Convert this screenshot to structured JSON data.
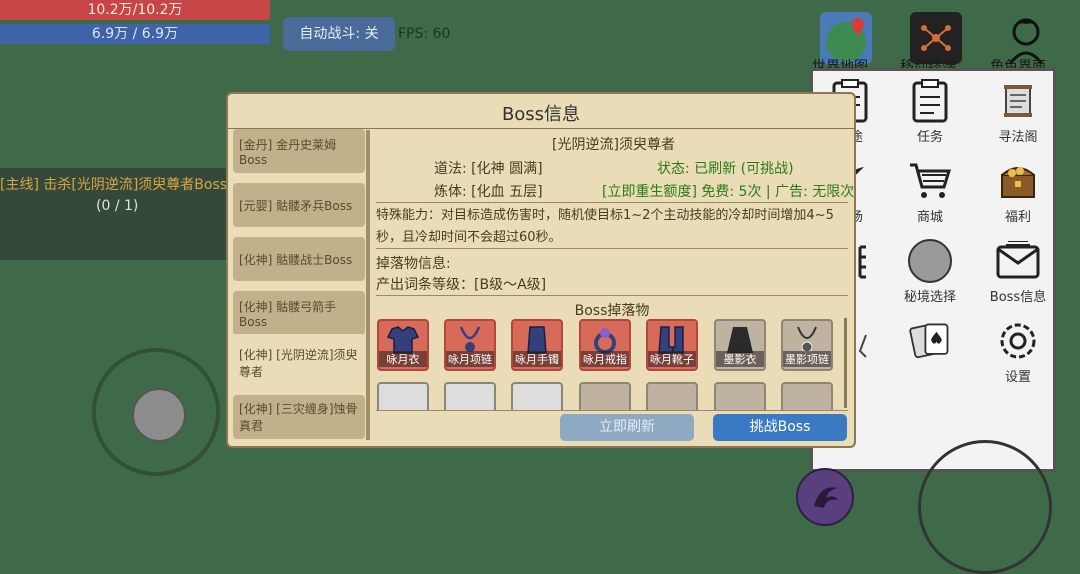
{
  "hud": {
    "hp": "10.2万/10.2万",
    "mp": "6.9万 / 6.9万",
    "auto_battle": "自动战斗: 关",
    "fps": "FPS: 60",
    "quest": "[主线] 击杀[光阴逆流]须臾尊者Boss",
    "quest_progress": "(0 / 1)"
  },
  "top_icons": [
    {
      "label": "世界地图",
      "icon": "map-pin-icon"
    },
    {
      "label": "移动终端",
      "icon": "network-icon"
    },
    {
      "label": "角色界面",
      "icon": "avatar-icon"
    }
  ],
  "side_menu": {
    "items": [
      {
        "label": "用途",
        "icon": "clipboard-icon"
      },
      {
        "label": "任务",
        "icon": "task-icon"
      },
      {
        "label": "寻法阁",
        "icon": "scroll-icon"
      },
      {
        "label": "商场",
        "icon": "feather-icon"
      },
      {
        "label": "商城",
        "icon": "cart-icon"
      },
      {
        "label": "福利",
        "icon": "treasure-icon"
      },
      {
        "label": "",
        "icon": "grid-icon"
      },
      {
        "label": "秘境选择",
        "icon": "circle-icon"
      },
      {
        "label": "Boss信息",
        "icon": "mail-icon"
      },
      {
        "label": "",
        "icon": "sword-icon"
      },
      {
        "label": "",
        "icon": "cards-icon"
      },
      {
        "label": "设置",
        "icon": "gear-icon"
      }
    ]
  },
  "modal": {
    "title": "Boss信息",
    "list": [
      "[金丹] 金丹史莱姆Boss",
      "[元婴] 骷髅矛兵Boss",
      "[化神] 骷髅战士Boss",
      "[化神] 骷髅弓箭手Boss",
      "[化神] [光阴逆流]须臾尊者",
      "[化神] [三灾缠身]蚀骨真君"
    ],
    "selected_index": 4,
    "detail": {
      "name": "[光阴逆流]须臾尊者",
      "dao": "道法: [化神 圆满]",
      "status": "状态: 已刷新 (可挑战)",
      "body": "炼体: [化血 五层]",
      "respawn": "[立即重生额度] 免费: 5次 | 广告: 无限次",
      "ability": "特殊能力：对目标造成伤害时，随机使目标1~2个主动技能的冷却时间增加4~5秒，且冷却时间不会超过60秒。",
      "drop_info_title": "掉落物信息:",
      "drop_grade": "产出词条等级：[B级～A级]",
      "drops_title": "Boss掉落物"
    },
    "drops": [
      {
        "label": "咏月衣",
        "style": "red",
        "icon": "armor-icon"
      },
      {
        "label": "咏月项链",
        "style": "red",
        "icon": "necklace-icon"
      },
      {
        "label": "咏月手镯",
        "style": "red",
        "icon": "bracer-icon"
      },
      {
        "label": "咏月戒指",
        "style": "red",
        "icon": "ring-icon"
      },
      {
        "label": "咏月靴子",
        "style": "red",
        "icon": "boots-icon"
      },
      {
        "label": "墨影衣",
        "style": "gray",
        "icon": "robe-icon"
      },
      {
        "label": "墨影项链",
        "style": "gray",
        "icon": "necklace-icon"
      }
    ],
    "buttons": {
      "refresh": "立即刷新",
      "challenge": "挑战Boss"
    }
  }
}
